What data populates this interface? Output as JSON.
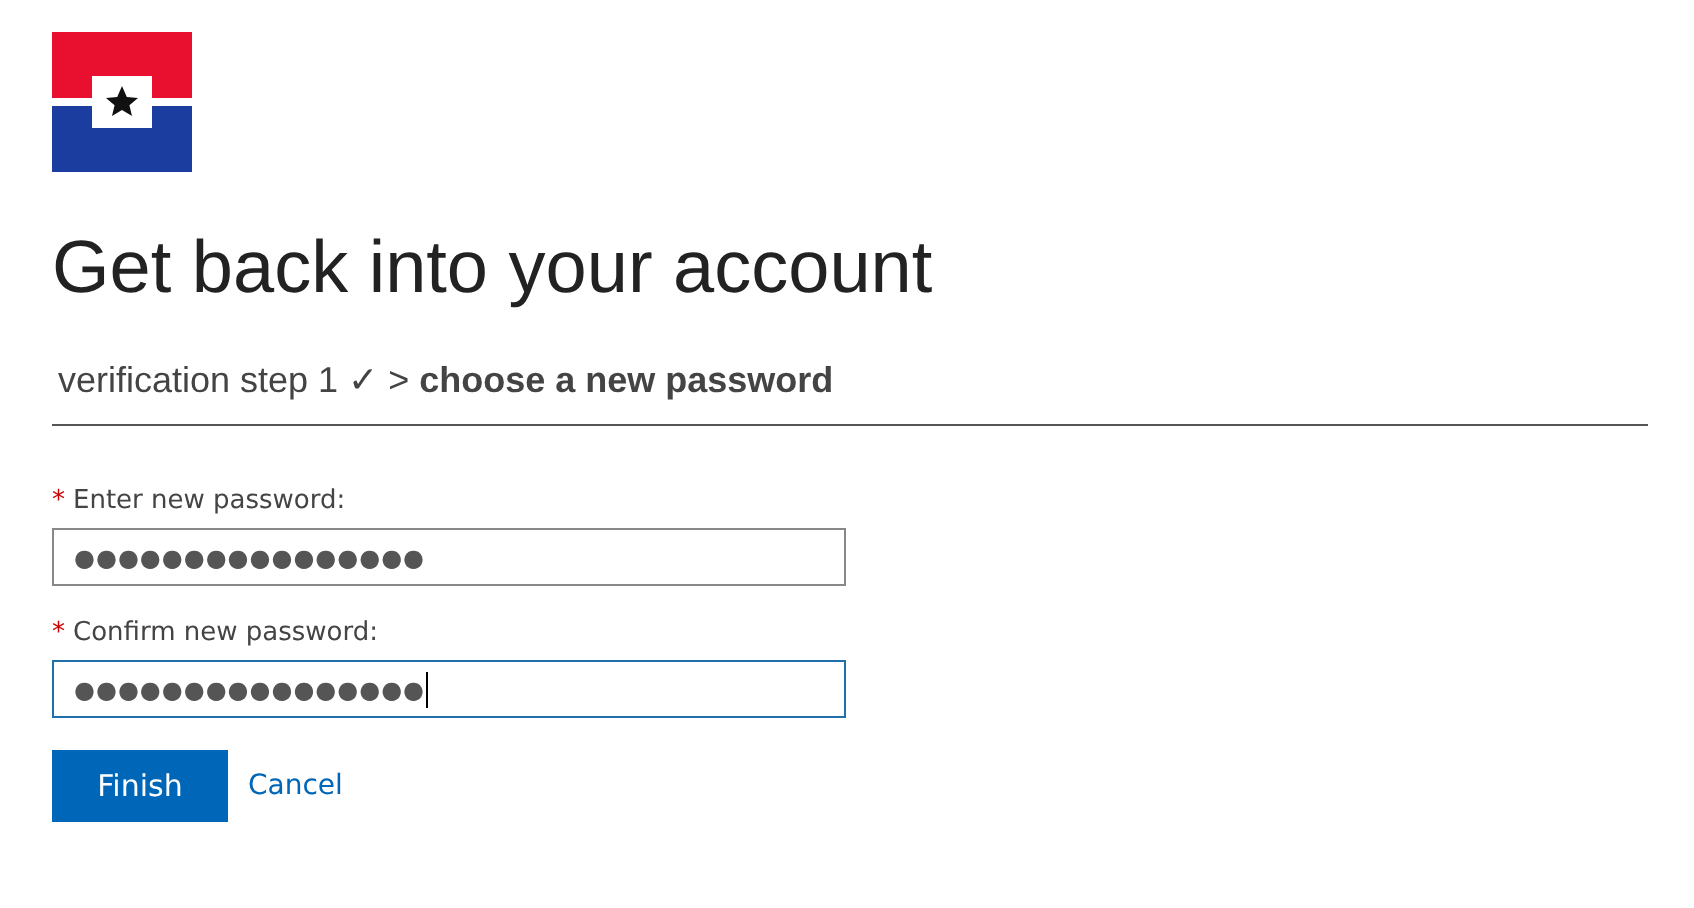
{
  "title": "Get back into your account",
  "breadcrumb": "verification step 1 ✓ > **choose a new password**",
  "fields": [
    {
      "required_mark": "*",
      "label": "Enter new password:",
      "value": "●●●●●●●●●●●●●●●●",
      "focused": false
    },
    {
      "required_mark": "*",
      "label": "Confirm new password:",
      "value": "●●●●●●●●●●●●●●●●",
      "focused": true
    }
  ],
  "buttons": [
    {
      "label": "Finish",
      "kind": "primary"
    },
    {
      "label": "Cancel",
      "kind": "link"
    }
  ]
}
